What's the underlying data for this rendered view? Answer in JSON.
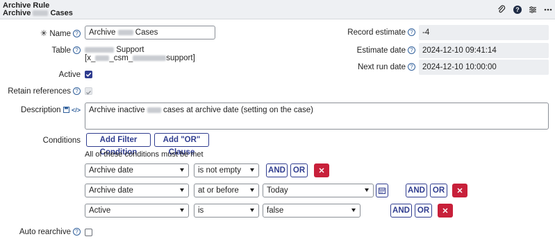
{
  "header": {
    "title_line1": "Archive Rule",
    "title_line2_prefix": "Archive",
    "title_line2_suffix": "Cases",
    "icons": [
      "paperclip-icon",
      "help-circle-icon",
      "settings-sliders-icon",
      "more-dots-icon"
    ]
  },
  "form": {
    "name_label": "Name",
    "name_prefix": "Archive",
    "name_suffix": "Cases",
    "table_label": "Table",
    "table_line1_suffix": "Support",
    "table_line2_prefix": "[x_",
    "table_line2_mid": "_csm_",
    "table_line2_suffix": "support]",
    "active_label": "Active",
    "active_checked": true,
    "retain_label": "Retain references",
    "retain_checked": true,
    "description_label": "Description",
    "description_prefix": "Archive inactive",
    "description_suffix": "cases at archive date (setting on the case)",
    "conditions_label": "Conditions",
    "add_filter_label": "Add Filter Condition",
    "add_or_label": "Add \"OR\" Clause",
    "conditions_note": "All of these conditions must be met",
    "auto_rearchive_label": "Auto rearchive",
    "auto_rearchive_checked": false
  },
  "right": {
    "record_estimate_label": "Record estimate",
    "record_estimate_value": "-4",
    "estimate_date_label": "Estimate date",
    "estimate_date_value": "2024-12-10 09:41:14",
    "next_run_label": "Next run date",
    "next_run_value": "2024-12-10 10:00:00"
  },
  "conditions": [
    {
      "field": "Archive date",
      "operator": "is not empty",
      "value": null
    },
    {
      "field": "Archive date",
      "operator": "at or before",
      "value": "Today"
    },
    {
      "field": "Active",
      "operator": "is",
      "value": "false"
    }
  ],
  "and_label": "AND",
  "or_label": "OR",
  "colors": {
    "primary": "#2f3c8f",
    "delete": "#c8203a",
    "checkbox": "#2f3c8f"
  }
}
